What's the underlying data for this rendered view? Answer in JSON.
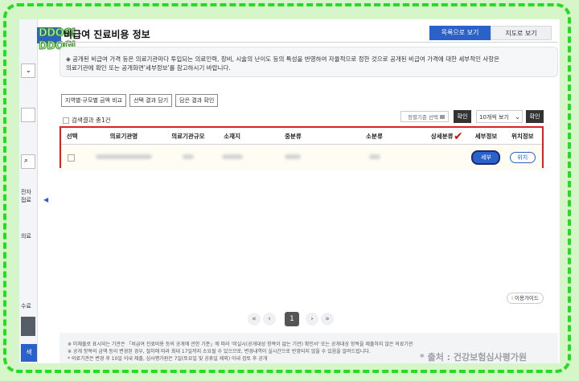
{
  "logo": {
    "line1": "DDOGI",
    "line2": "DDOGI"
  },
  "page": {
    "title": "비급여 진료비용 정보"
  },
  "view_buttons": {
    "list": "목록으로 보기",
    "map": "지도로 보기"
  },
  "notice": {
    "text": "◈ 공개된 비급여 가격 등은 의료기관마다 투입되는 의료인력, 장비, 시술의 난이도 등의 특성을 반영하여 자율적으로 정한 것으로 공개된 비급여 가격에 대한 세부적인 사항은 의료기관에 확인 또는 공개화면'세부정보'를 참고하시기 바랍니다."
  },
  "filter_tabs": [
    "지역별·규모별 금액 비교",
    "선택 결과 담기",
    "담은 결과 확인"
  ],
  "results": {
    "label": "검색결과 총1건"
  },
  "sort": {
    "placeholder": "정렬기준 선택",
    "confirm": "확인"
  },
  "per_page": {
    "selected": "10개씩 보기",
    "confirm": "확인"
  },
  "table": {
    "headers": [
      "선택",
      "의료기관명",
      "의료기관규모",
      "소재지",
      "중분류",
      "소분류",
      "상세분류",
      "세부정보",
      "위치정보"
    ],
    "row": {
      "detail_button": "세부",
      "location_button": "위치"
    }
  },
  "guide": {
    "icon": "i",
    "label": "이용가이드"
  },
  "pagination": {
    "first": "«",
    "prev": "‹",
    "current": "1",
    "next": "›",
    "last": "»"
  },
  "footer_notes": [
    "※ 미체출로 표시되는 기관은 「비급여 진료비용 등의 공개에 관한 기준」에 따라 '미실시(공개대상 항목이 없는 기관) 확인서' 또는 공개대상 항목을 제출하지 않은 의료기관",
    "※ 공개 항목의 금액 등이 변경된 경우, 절차에 따라 최대 17일까지 소요될 수 있으므로, 변경내역이 실시간으로 반영되지 않을 수 있음을 알려드립니다.",
    "* 의료기관은 변경 후 10일 이내 제출, 심사평가원은 7일(토요일 및 공휴일 제외) 이내 검토 후 공개"
  ],
  "source": "* 출처 : 건강보험심사평가원",
  "sidebar": {
    "items": [
      "전자",
      "접료",
      "의료",
      "수료",
      "색"
    ]
  },
  "accent_colors": {
    "primary": "#2a62c9",
    "highlight": "#e02020",
    "frame": "#22dd22"
  }
}
